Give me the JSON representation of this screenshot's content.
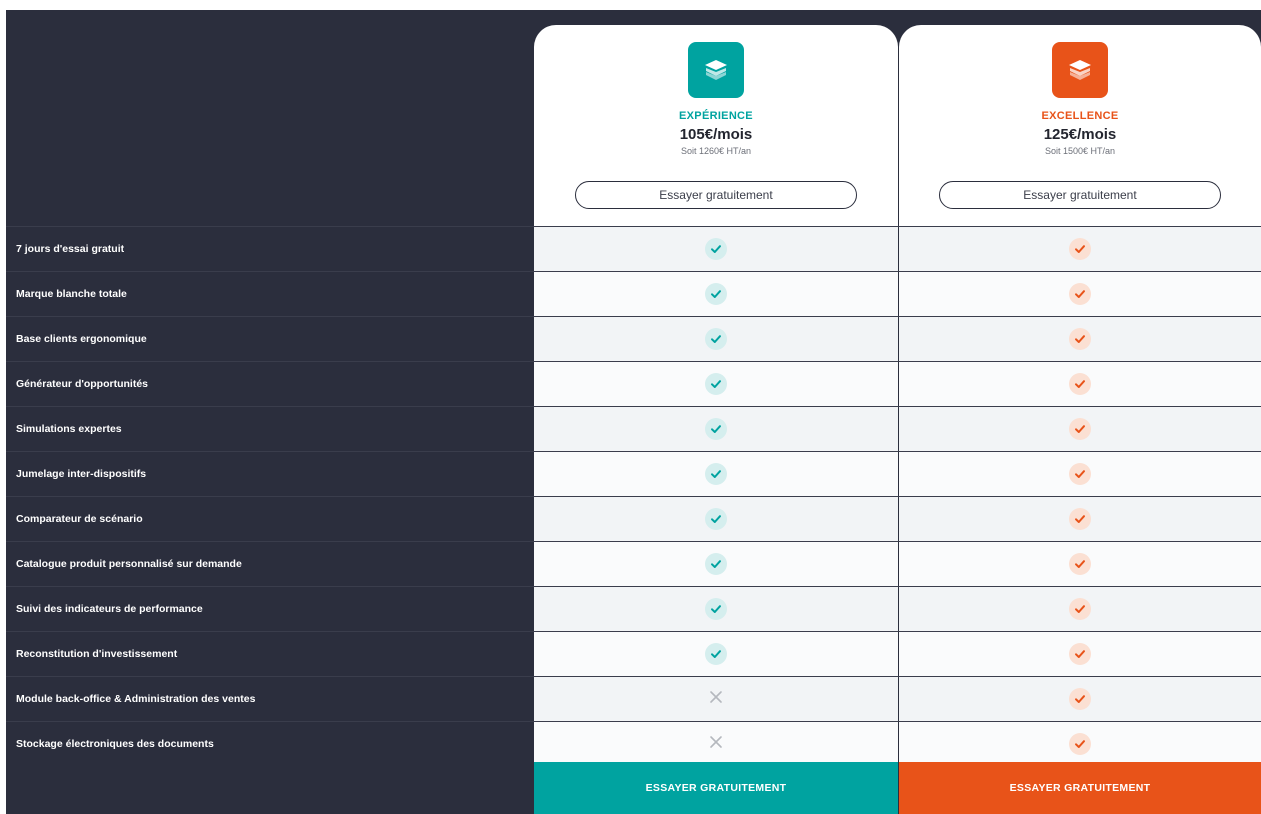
{
  "colors": {
    "teal": "#00a3a0",
    "orange": "#e85319",
    "dark_bg": "#2b2e3d"
  },
  "plans": [
    {
      "name": "EXPÉRIENCE",
      "price": "105€/mois",
      "annual": "Soit 1260€ HT/an",
      "button": "Essayer gratuitement",
      "cta": "ESSAYER GRATUITEMENT",
      "icon": "layers-icon",
      "color": "#00a3a0"
    },
    {
      "name": "EXCELLENCE",
      "price": "125€/mois",
      "annual": "Soit 1500€ HT/an",
      "button": "Essayer gratuitement",
      "cta": "ESSAYER GRATUITEMENT",
      "icon": "layers-icon",
      "color": "#e85319"
    }
  ],
  "features": [
    {
      "label": "7 jours d'essai gratuit",
      "plan1": true,
      "plan2": true
    },
    {
      "label": "Marque blanche totale",
      "plan1": true,
      "plan2": true
    },
    {
      "label": "Base clients ergonomique",
      "plan1": true,
      "plan2": true
    },
    {
      "label": "Générateur d'opportunités",
      "plan1": true,
      "plan2": true
    },
    {
      "label": "Simulations expertes",
      "plan1": true,
      "plan2": true
    },
    {
      "label": "Jumelage inter-dispositifs",
      "plan1": true,
      "plan2": true
    },
    {
      "label": "Comparateur de scénario",
      "plan1": true,
      "plan2": true
    },
    {
      "label": "Catalogue produit personnalisé sur demande",
      "plan1": true,
      "plan2": true
    },
    {
      "label": "Suivi des indicateurs de performance",
      "plan1": true,
      "plan2": true
    },
    {
      "label": "Reconstitution d'investissement",
      "plan1": true,
      "plan2": true
    },
    {
      "label": "Module back-office & Administration des ventes",
      "plan1": false,
      "plan2": true
    },
    {
      "label": "Stockage électroniques des documents",
      "plan1": false,
      "plan2": true
    }
  ]
}
